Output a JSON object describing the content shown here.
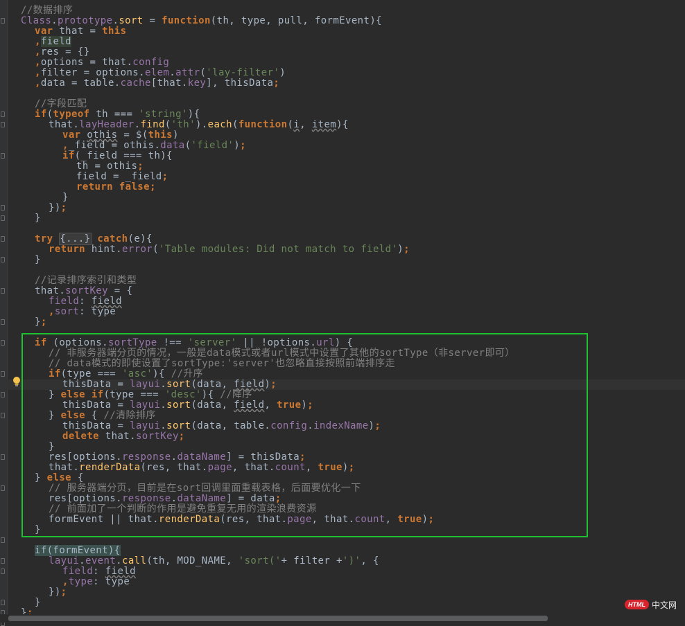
{
  "editor": {
    "language": "javascript",
    "current_line_index": 36,
    "lines": [
      {
        "i": 0,
        "tokens": [
          [
            "cm",
            "//数据排序"
          ]
        ]
      },
      {
        "i": 0,
        "tokens": [
          [
            "p",
            "Class"
          ],
          [
            "t",
            "."
          ],
          [
            "prop",
            "prototype"
          ],
          [
            "t",
            "."
          ],
          [
            "fn",
            "sort"
          ],
          [
            "t",
            " = "
          ],
          [
            "kw",
            "function"
          ],
          [
            "t",
            "(th, type, pull, formEvent){"
          ]
        ]
      },
      {
        "i": 1,
        "tokens": [
          [
            "kw",
            "var"
          ],
          [
            "t",
            " that = "
          ],
          [
            "kw",
            "this"
          ]
        ]
      },
      {
        "i": 1,
        "tokens": [
          [
            "kw",
            ","
          ],
          [
            "hl",
            "field"
          ]
        ]
      },
      {
        "i": 1,
        "tokens": [
          [
            "kw",
            ","
          ],
          [
            "t",
            "res = {}"
          ]
        ]
      },
      {
        "i": 1,
        "tokens": [
          [
            "kw",
            ","
          ],
          [
            "t",
            "options = that."
          ],
          [
            "prop",
            "config"
          ]
        ]
      },
      {
        "i": 1,
        "tokens": [
          [
            "kw",
            ","
          ],
          [
            "t",
            "filter = options."
          ],
          [
            "prop",
            "elem"
          ],
          [
            "t",
            "."
          ],
          [
            "prop",
            "attr"
          ],
          [
            "t",
            "("
          ],
          [
            "str",
            "'lay-filter'"
          ],
          [
            "t",
            ")"
          ]
        ]
      },
      {
        "i": 1,
        "tokens": [
          [
            "kw",
            ","
          ],
          [
            "t",
            "data = table."
          ],
          [
            "prop",
            "cache"
          ],
          [
            "t",
            "[that."
          ],
          [
            "prop",
            "key"
          ],
          [
            "t",
            "], thisData"
          ],
          [
            "kw",
            ";"
          ]
        ]
      },
      {
        "i": 0,
        "tokens": []
      },
      {
        "i": 1,
        "tokens": [
          [
            "cm",
            "//字段匹配"
          ]
        ]
      },
      {
        "i": 1,
        "tokens": [
          [
            "kw",
            "if"
          ],
          [
            "t",
            "("
          ],
          [
            "kw",
            "typeof"
          ],
          [
            "t",
            " th === "
          ],
          [
            "str",
            "'string'"
          ],
          [
            "t",
            "){"
          ]
        ]
      },
      {
        "i": 2,
        "tokens": [
          [
            "t",
            "that."
          ],
          [
            "prop",
            "layHeader"
          ],
          [
            "t",
            "."
          ],
          [
            "fn",
            "find"
          ],
          [
            "t",
            "("
          ],
          [
            "str",
            "'th'"
          ],
          [
            "t",
            ")."
          ],
          [
            "fn",
            "each"
          ],
          [
            "t",
            "("
          ],
          [
            "kw",
            "function"
          ],
          [
            "t",
            "("
          ],
          [
            "warn",
            "i"
          ],
          [
            "t",
            ", "
          ],
          [
            "warn",
            "item"
          ],
          [
            "t",
            "){"
          ]
        ]
      },
      {
        "i": 3,
        "tokens": [
          [
            "kw",
            "var"
          ],
          [
            "t",
            " "
          ],
          [
            "warn",
            "othis"
          ],
          [
            "t",
            " = $("
          ],
          [
            "kw",
            "this"
          ],
          [
            "t",
            ")"
          ]
        ]
      },
      {
        "i": 3,
        "tokens": [
          [
            "kw",
            ","
          ],
          [
            "t",
            "_field = othis."
          ],
          [
            "prop",
            "data"
          ],
          [
            "t",
            "("
          ],
          [
            "str",
            "'field'"
          ],
          [
            "t",
            ")"
          ],
          [
            "kw",
            ";"
          ]
        ]
      },
      {
        "i": 3,
        "tokens": [
          [
            "kw",
            "if"
          ],
          [
            "t",
            "(_field === th){"
          ]
        ]
      },
      {
        "i": 4,
        "tokens": [
          [
            "t",
            "th = othis"
          ],
          [
            "kw",
            ";"
          ]
        ]
      },
      {
        "i": 4,
        "tokens": [
          [
            "t",
            "field = _field"
          ],
          [
            "kw",
            ";"
          ]
        ]
      },
      {
        "i": 4,
        "tokens": [
          [
            "kw",
            "return false"
          ],
          [
            "kw",
            ";"
          ]
        ]
      },
      {
        "i": 3,
        "tokens": [
          [
            "t",
            "}"
          ]
        ]
      },
      {
        "i": 2,
        "tokens": [
          [
            "t",
            "})"
          ],
          [
            "kw",
            ";"
          ]
        ]
      },
      {
        "i": 1,
        "tokens": [
          [
            "t",
            "}"
          ]
        ]
      },
      {
        "i": 0,
        "tokens": []
      },
      {
        "i": 1,
        "tokens": [
          [
            "kw",
            "try"
          ],
          [
            "t",
            " "
          ],
          [
            "fold",
            "{...}"
          ],
          [
            "t",
            " "
          ],
          [
            "kw",
            "catch"
          ],
          [
            "t",
            "(e){"
          ]
        ]
      },
      {
        "i": 2,
        "tokens": [
          [
            "kw",
            "return"
          ],
          [
            "t",
            " hint."
          ],
          [
            "prop",
            "error"
          ],
          [
            "t",
            "("
          ],
          [
            "str",
            "'Table modules: Did not match to field'"
          ],
          [
            "t",
            ")"
          ],
          [
            "kw",
            ";"
          ]
        ]
      },
      {
        "i": 1,
        "tokens": [
          [
            "t",
            "}"
          ]
        ]
      },
      {
        "i": 0,
        "tokens": []
      },
      {
        "i": 1,
        "tokens": [
          [
            "cm",
            "//记录排序索引和类型"
          ]
        ]
      },
      {
        "i": 1,
        "tokens": [
          [
            "t",
            "that."
          ],
          [
            "prop",
            "sortKey"
          ],
          [
            "t",
            " = {"
          ]
        ]
      },
      {
        "i": 2,
        "tokens": [
          [
            "prop",
            "field"
          ],
          [
            "t",
            ": "
          ],
          [
            "warn",
            "field"
          ]
        ]
      },
      {
        "i": 2,
        "tokens": [
          [
            "kw",
            ","
          ],
          [
            "prop",
            "sort"
          ],
          [
            "t",
            ": type"
          ]
        ]
      },
      {
        "i": 1,
        "tokens": [
          [
            "t",
            "}"
          ],
          [
            "kw",
            ";"
          ]
        ]
      },
      {
        "i": 0,
        "tokens": []
      },
      {
        "i": 1,
        "tokens": [
          [
            "kw",
            "if"
          ],
          [
            "t",
            " (options."
          ],
          [
            "prop",
            "sortType"
          ],
          [
            "t",
            " !== "
          ],
          [
            "str",
            "'server'"
          ],
          [
            "t",
            " || !options."
          ],
          [
            "prop",
            "url"
          ],
          [
            "t",
            ") {"
          ]
        ]
      },
      {
        "i": 2,
        "tokens": [
          [
            "cm",
            "// 非服务器端分页的情况，一般是data模式或者url模式中设置了其他的sortType（非server即可）"
          ]
        ]
      },
      {
        "i": 2,
        "tokens": [
          [
            "cm",
            "// data模式的即使设置了sortType:'server'也忽略直接按照前端排序走"
          ]
        ]
      },
      {
        "i": 2,
        "tokens": [
          [
            "kw",
            "if"
          ],
          [
            "t",
            "(type === "
          ],
          [
            "str",
            "'asc'"
          ],
          [
            "t",
            "){ "
          ],
          [
            "cm",
            "//升序"
          ]
        ]
      },
      {
        "i": 3,
        "tokens": [
          [
            "t",
            "thisData = "
          ],
          [
            "prop",
            "layui"
          ],
          [
            "t",
            "."
          ],
          [
            "fn",
            "sort"
          ],
          [
            "t",
            "(data, "
          ],
          [
            "warn",
            "field"
          ],
          [
            "t",
            ")"
          ],
          [
            "kw",
            ";"
          ]
        ]
      },
      {
        "i": 2,
        "tokens": [
          [
            "t",
            "} "
          ],
          [
            "kw",
            "else if"
          ],
          [
            "t",
            "(type === "
          ],
          [
            "str",
            "'desc'"
          ],
          [
            "t",
            "){ "
          ],
          [
            "cm",
            "//降序"
          ]
        ]
      },
      {
        "i": 3,
        "tokens": [
          [
            "t",
            "thisData = "
          ],
          [
            "prop",
            "layui"
          ],
          [
            "t",
            "."
          ],
          [
            "fn",
            "sort"
          ],
          [
            "t",
            "(data, "
          ],
          [
            "warn",
            "field"
          ],
          [
            "t",
            ", "
          ],
          [
            "kw",
            "true"
          ],
          [
            "t",
            ")"
          ],
          [
            "kw",
            ";"
          ]
        ]
      },
      {
        "i": 2,
        "tokens": [
          [
            "t",
            "} "
          ],
          [
            "kw",
            "else"
          ],
          [
            "t",
            " { "
          ],
          [
            "cm",
            "//清除排序"
          ]
        ]
      },
      {
        "i": 3,
        "tokens": [
          [
            "t",
            "thisData = "
          ],
          [
            "prop",
            "layui"
          ],
          [
            "t",
            "."
          ],
          [
            "fn",
            "sort"
          ],
          [
            "t",
            "(data, table."
          ],
          [
            "prop",
            "config"
          ],
          [
            "t",
            "."
          ],
          [
            "prop",
            "indexName"
          ],
          [
            "t",
            ")"
          ],
          [
            "kw",
            ";"
          ]
        ]
      },
      {
        "i": 3,
        "tokens": [
          [
            "kw",
            "delete"
          ],
          [
            "t",
            " that."
          ],
          [
            "prop",
            "sortKey"
          ],
          [
            "kw",
            ";"
          ]
        ]
      },
      {
        "i": 2,
        "tokens": [
          [
            "t",
            "}"
          ]
        ]
      },
      {
        "i": 2,
        "tokens": [
          [
            "t",
            "res[options."
          ],
          [
            "prop",
            "response"
          ],
          [
            "t",
            "."
          ],
          [
            "prop",
            "dataName"
          ],
          [
            "t",
            "] = thisData"
          ],
          [
            "kw",
            ";"
          ]
        ]
      },
      {
        "i": 2,
        "tokens": [
          [
            "t",
            "that."
          ],
          [
            "fn",
            "renderData"
          ],
          [
            "t",
            "(res, that."
          ],
          [
            "prop",
            "page"
          ],
          [
            "t",
            ", that."
          ],
          [
            "prop",
            "count"
          ],
          [
            "t",
            ", "
          ],
          [
            "kw",
            "true"
          ],
          [
            "t",
            ")"
          ],
          [
            "kw",
            ";"
          ]
        ]
      },
      {
        "i": 1,
        "tokens": [
          [
            "t",
            "} "
          ],
          [
            "kw",
            "else"
          ],
          [
            "t",
            " {"
          ]
        ]
      },
      {
        "i": 2,
        "tokens": [
          [
            "cm",
            "// 服务器端分页，目前是在sort回调里面重载表格，后面要优化一下"
          ]
        ]
      },
      {
        "i": 2,
        "tokens": [
          [
            "t",
            "res[options."
          ],
          [
            "prop",
            "response"
          ],
          [
            "t",
            "."
          ],
          [
            "prop",
            "dataName"
          ],
          [
            "t",
            "] = data"
          ],
          [
            "kw",
            ";"
          ]
        ]
      },
      {
        "i": 2,
        "tokens": [
          [
            "cm",
            "// 前面加了一个判断的作用是避免重复无用的渲染浪费资源"
          ]
        ]
      },
      {
        "i": 2,
        "tokens": [
          [
            "t",
            "formEvent || that."
          ],
          [
            "fn",
            "renderData"
          ],
          [
            "t",
            "(res, that."
          ],
          [
            "prop",
            "page"
          ],
          [
            "t",
            ", that."
          ],
          [
            "prop",
            "count"
          ],
          [
            "t",
            ", "
          ],
          [
            "kw",
            "true"
          ],
          [
            "t",
            ")"
          ],
          [
            "kw",
            ";"
          ]
        ]
      },
      {
        "i": 1,
        "tokens": [
          [
            "t",
            "}"
          ]
        ]
      },
      {
        "i": 0,
        "tokens": []
      },
      {
        "i": 1,
        "tokens": [
          [
            "hlg",
            "if(formEvent){"
          ]
        ]
      },
      {
        "i": 2,
        "tokens": [
          [
            "prop",
            "layui"
          ],
          [
            "t",
            "."
          ],
          [
            "prop",
            "event"
          ],
          [
            "t",
            "."
          ],
          [
            "fn",
            "call"
          ],
          [
            "t",
            "(th, MOD_NAME, "
          ],
          [
            "str",
            "'sort('"
          ],
          [
            "t",
            "+ filter +"
          ],
          [
            "str",
            "')'"
          ],
          [
            "t",
            ", {"
          ]
        ]
      },
      {
        "i": 3,
        "tokens": [
          [
            "prop",
            "field"
          ],
          [
            "t",
            ": "
          ],
          [
            "warn",
            "field"
          ]
        ]
      },
      {
        "i": 3,
        "tokens": [
          [
            "kw",
            ","
          ],
          [
            "prop",
            "type"
          ],
          [
            "t",
            ": type"
          ]
        ]
      },
      {
        "i": 2,
        "tokens": [
          [
            "t",
            "})"
          ],
          [
            "kw",
            ";"
          ]
        ]
      },
      {
        "i": 1,
        "tokens": [
          [
            "t",
            "}"
          ]
        ]
      },
      {
        "i": 0,
        "tokens": [
          [
            "t",
            "}"
          ],
          [
            "kw",
            ";"
          ]
        ]
      }
    ]
  },
  "highlight_box_color": "#1fc230",
  "watermark": {
    "logo_text": "HTML",
    "site_text": "中文网"
  }
}
